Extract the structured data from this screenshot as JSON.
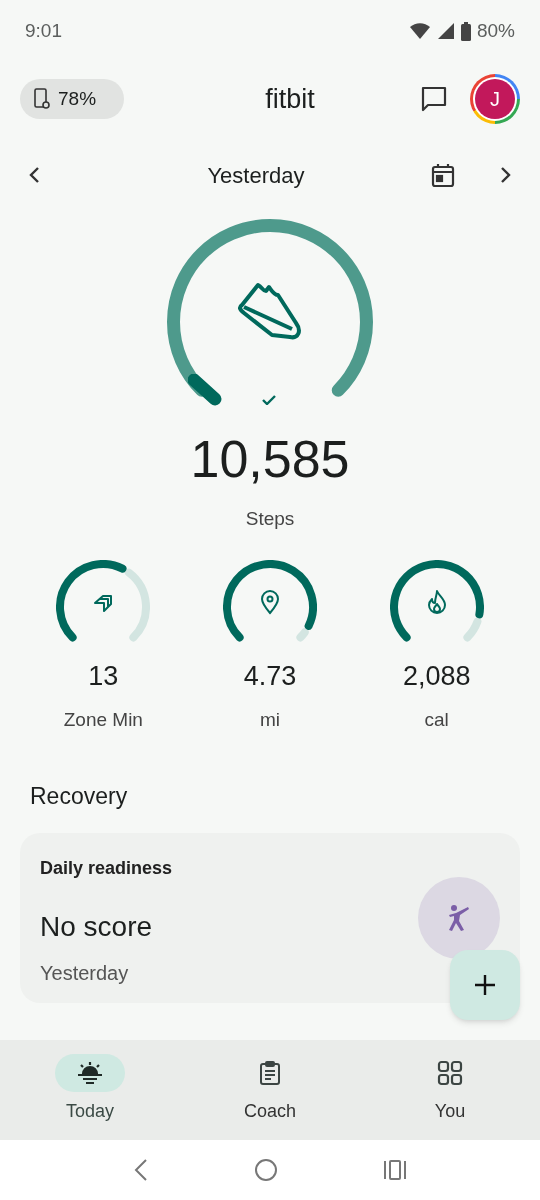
{
  "status_bar": {
    "time": "9:01",
    "battery": "80%"
  },
  "header": {
    "device_battery": "78%",
    "title": "fitbit",
    "avatar": "J"
  },
  "date_nav": {
    "label": "Yesterday"
  },
  "steps": {
    "value": "10,585",
    "label": "Steps",
    "goal_met": true
  },
  "stats": [
    {
      "kind": "zone",
      "value": "13",
      "label": "Zone Min"
    },
    {
      "kind": "distance",
      "value": "4.73",
      "label": "mi"
    },
    {
      "kind": "calories",
      "value": "2,088",
      "label": "cal"
    }
  ],
  "section_title": "Recovery",
  "readiness_card": {
    "title": "Daily readiness",
    "score": "No score",
    "date": "Yesterday"
  },
  "bottom_nav": [
    {
      "kind": "today",
      "label": "Today",
      "selected": true
    },
    {
      "kind": "coach",
      "label": "Coach",
      "selected": false
    },
    {
      "kind": "you",
      "label": "You",
      "selected": false
    }
  ]
}
